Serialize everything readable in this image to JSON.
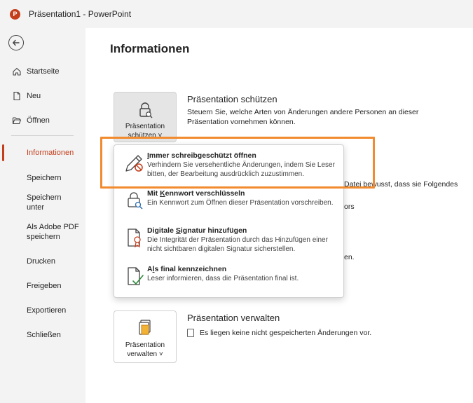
{
  "window": {
    "title": "Präsentation1  -  PowerPoint",
    "app_icon_letter": "P"
  },
  "sidebar": {
    "top_items": [
      {
        "label": "Startseite",
        "icon": "home-icon"
      },
      {
        "label": "Neu",
        "icon": "new-document-icon"
      },
      {
        "label": "Öffnen",
        "icon": "folder-open-icon"
      }
    ],
    "items": [
      {
        "label": "Informationen",
        "active": true
      },
      {
        "label": "Speichern"
      },
      {
        "label": "Speichern unter"
      },
      {
        "label": "Als Adobe PDF speichern"
      },
      {
        "label": "Drucken"
      },
      {
        "label": "Freigeben"
      },
      {
        "label": "Exportieren"
      },
      {
        "label": "Schließen"
      }
    ]
  },
  "main": {
    "title": "Informationen",
    "protect": {
      "tile_label_line1": "Präsentation",
      "tile_label_line2": "schützen ˅",
      "heading": "Präsentation schützen",
      "description": "Steuern Sie, welche Arten von Änderungen andere Personen an dieser Präsentation vornehmen können."
    },
    "partial_texts": {
      "line1": "Datei bewusst, dass sie Folgendes",
      "line2": "ors",
      "line3": "en."
    },
    "manage": {
      "tile_label_line1": "Präsentation",
      "tile_label_line2": "verwalten ˅",
      "heading": "Präsentation verwalten",
      "status": "Es liegen keine nicht gespeicherten Änderungen vor."
    }
  },
  "dropdown": {
    "items": [
      {
        "title_pre": "",
        "title_u": "I",
        "title_post": "mmer schreibgeschützt öffnen",
        "desc": "Verhindern Sie versehentliche Änderungen, indem Sie Leser bitten, der Bearbeitung ausdrücklich zuzustimmen.",
        "icon": "pencil-blocked-icon"
      },
      {
        "title_pre": "Mit ",
        "title_u": "K",
        "title_post": "ennwort verschlüsseln",
        "desc": "Ein Kennwort zum Öffnen dieser Präsentation vorschreiben.",
        "icon": "lock-search-icon"
      },
      {
        "title_pre": "Digitale ",
        "title_u": "S",
        "title_post": "ignatur hinzufügen",
        "desc": "Die Integrität der Präsentation durch das Hinzufügen einer nicht sichtbaren digitalen Signatur sicherstellen.",
        "icon": "signature-ribbon-icon"
      },
      {
        "title_pre": "A",
        "title_u": "l",
        "title_post": "s final kennzeichnen",
        "desc": "Leser informieren, dass die Präsentation final ist.",
        "icon": "document-check-icon"
      }
    ]
  },
  "colors": {
    "accent": "#c43e1c",
    "highlight": "#f28a2e",
    "sidebar_bg": "#f3f3f3"
  }
}
